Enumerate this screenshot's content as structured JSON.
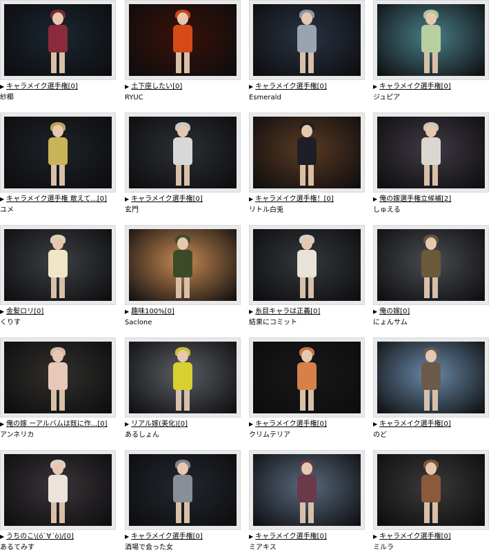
{
  "items": [
    {
      "title": "キャラメイク選手権[0]",
      "author": "紗椰",
      "bg": "#1b2630",
      "accent": "#8a2a3a"
    },
    {
      "title": "土下座したい[0]",
      "author": "RYUC",
      "bg": "#3a1208",
      "accent": "#d64a1a"
    },
    {
      "title": "キャラメイク選手権[0]",
      "author": "Esmerald",
      "bg": "#2a3342",
      "accent": "#9aa4b0"
    },
    {
      "title": "キャラメイク選手権[0]",
      "author": "ジュピア",
      "bg": "#4a7e88",
      "accent": "#b8d0a0"
    },
    {
      "title": "キャラメイク選手権 敢えて...[0]",
      "author": "ユメ",
      "bg": "#1e2228",
      "accent": "#c9b45a"
    },
    {
      "title": "キャラメイク選手権[0]",
      "author": "玄門",
      "bg": "#2c2f33",
      "accent": "#d8d8d8"
    },
    {
      "title": "キャラメイク選手権！[0]",
      "author": "リトル白兎",
      "bg": "#5a3a22",
      "accent": "#1e1e28"
    },
    {
      "title": "俺の嫁選手権立候補[2]",
      "author": "しゅえる",
      "bg": "#3f3a44",
      "accent": "#dcd6d0"
    },
    {
      "title": "金髪ロリ[0]",
      "author": "くりす",
      "bg": "#3c4044",
      "accent": "#efe6c8"
    },
    {
      "title": "趣味100%[0]",
      "author": "Saclone",
      "bg": "#c88a52",
      "accent": "#3c4a28"
    },
    {
      "title": "糸目キャラは正義[0]",
      "author": "結果にコミット",
      "bg": "#34383c",
      "accent": "#e8e2d8"
    },
    {
      "title": "俺の嫁[0]",
      "author": "にょんサム",
      "bg": "#4a4c52",
      "accent": "#6a5a3a"
    },
    {
      "title": "俺の嫁 ーアルバムは既に作...[0]",
      "author": "アンネリカ",
      "bg": "#32302c",
      "accent": "#e8c8b8"
    },
    {
      "title": "リアル嫁(美化)[0]",
      "author": "あるしょん",
      "bg": "#5a5e64",
      "accent": "#d8d030"
    },
    {
      "title": "キャラメイク選手権[0]",
      "author": "クリムテリア",
      "bg": "#1a1818",
      "accent": "#d8804a"
    },
    {
      "title": "キャラメイク選手権[0]",
      "author": "のど",
      "bg": "#6a8aa8",
      "accent": "#6a5a4a"
    },
    {
      "title": "うちのこ\\(ó`∀´ò)/[0]",
      "author": "あるてみす",
      "bg": "#3a3438",
      "accent": "#ece4dc"
    },
    {
      "title": "キャラメイク選手権[0]",
      "author": "酒場で会った女",
      "bg": "#22282e",
      "accent": "#8a8e98"
    },
    {
      "title": "キャラメイク選手権[0]",
      "author": "ミアキス",
      "bg": "#5a6a7e",
      "accent": "#6a3a4a"
    },
    {
      "title": "キャラメイク選手権[0]",
      "author": "ミルラ",
      "bg": "#3a3a3a",
      "accent": "#8a5a3a"
    }
  ]
}
